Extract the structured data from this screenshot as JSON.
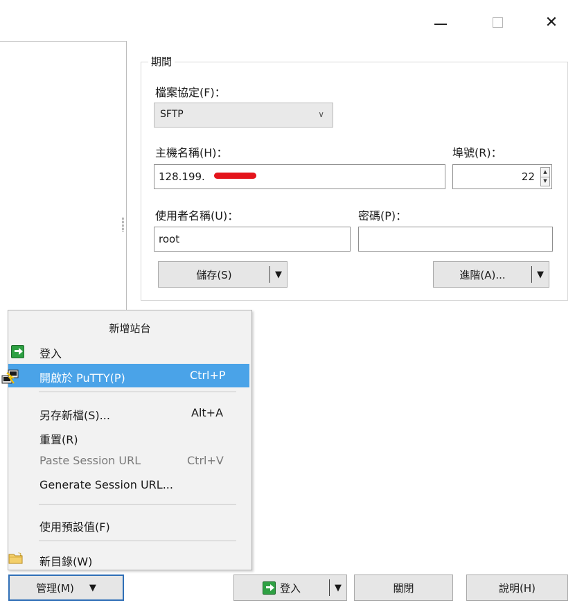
{
  "window": {
    "minimize_label": "—",
    "close_label": "✕"
  },
  "group": {
    "title": "期間",
    "protocol_label": "檔案協定(F)：",
    "protocol_value": "SFTP",
    "host_label": "主機名稱(H)：",
    "host_value": "128.199.",
    "port_label": "埠號(R)：",
    "port_value": "22",
    "user_label": "使用者名稱(U)：",
    "user_value": "root",
    "password_label": "密碼(P)：",
    "password_value": "",
    "save_button": "儲存(S)",
    "advanced_button": "進階(A)...",
    "dropdown_glyph": "▼"
  },
  "menu": {
    "header": "新增站台",
    "items": [
      {
        "label": "登入",
        "shortcut": "",
        "icon": "login-icon"
      },
      {
        "label": "開啟於 PuTTY(P)",
        "shortcut": "Ctrl+P",
        "icon": "putty-icon"
      },
      {
        "label": "另存新檔(S)...",
        "shortcut": "Alt+A"
      },
      {
        "label": "重置(R)",
        "shortcut": ""
      },
      {
        "label": "Paste Session URL",
        "shortcut": "Ctrl+V"
      },
      {
        "label": "Generate Session URL...",
        "shortcut": ""
      },
      {
        "label": "使用預設值(F)",
        "shortcut": ""
      },
      {
        "label": "新目錄(W)",
        "shortcut": "",
        "icon": "folder-icon"
      }
    ]
  },
  "footer": {
    "manage_button": "管理(M)",
    "login_button": "登入",
    "close_button": "關閉",
    "help_button": "說明(H)",
    "dropdown_glyph": "▼"
  },
  "colors": {
    "highlight": "#4aa3e8",
    "redaction": "#e4141b",
    "login_green": "#2ea043",
    "manage_focus_border": "#2f6fb7"
  }
}
